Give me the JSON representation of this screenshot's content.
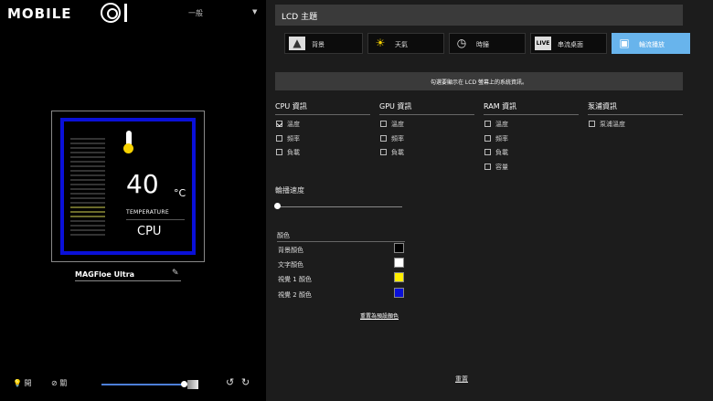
{
  "brand": {
    "logo_text": "MOBILE"
  },
  "profile": {
    "selected": "一般"
  },
  "preview": {
    "temperature_value": "40",
    "temperature_unit": "°C",
    "temperature_label": "TEMPERATURE",
    "source": "CPU",
    "colors": {
      "frame": "#0a10d8",
      "thermo_bulb": "#f6d200"
    }
  },
  "device": {
    "name": "MAGFloe Ultra"
  },
  "bottom": {
    "light_on": "開",
    "light_off": "關"
  },
  "lcd": {
    "header": "LCD 主題",
    "tabs": [
      {
        "label": "背景",
        "icon": "image-icon"
      },
      {
        "label": "天氣",
        "icon": "weather-icon"
      },
      {
        "label": "時鐘",
        "icon": "clock-icon"
      },
      {
        "label": "串流桌面",
        "icon": "live-icon",
        "icon_text": "LIVE"
      },
      {
        "label": "輪流播放",
        "icon": "slideshow-icon",
        "active": true
      }
    ],
    "hint": "勾選要顯示在 LCD 螢幕上的系統資訊。"
  },
  "info": {
    "cpu": {
      "title": "CPU 資訊",
      "items": [
        "溫度",
        "頻率",
        "負載"
      ]
    },
    "gpu": {
      "title": "GPU 資訊",
      "items": [
        "溫度",
        "頻率",
        "負載"
      ]
    },
    "ram": {
      "title": "RAM 資訊",
      "items": [
        "溫度",
        "頻率",
        "負載",
        "容量"
      ]
    },
    "pump": {
      "title": "泵浦資訊",
      "items": [
        "泵浦溫度"
      ]
    }
  },
  "rotation": {
    "label": "輪播速度"
  },
  "colors": {
    "title": "顏色",
    "rows": [
      {
        "label": "背景顏色",
        "value": "#000000"
      },
      {
        "label": "文字顏色",
        "value": "#ffffff"
      },
      {
        "label": "視覺 1 顏色",
        "value": "#ffee00"
      },
      {
        "label": "視覺 2 顏色",
        "value": "#0a10d8"
      }
    ],
    "reset": "重置為預設顏色"
  },
  "footer": {
    "reset": "重置"
  }
}
